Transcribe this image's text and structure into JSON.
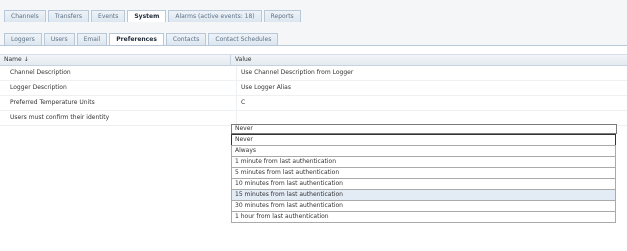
{
  "top_tabs": [
    {
      "label": "Channels"
    },
    {
      "label": "Transfers"
    },
    {
      "label": "Events"
    },
    {
      "label": "System",
      "active": true
    },
    {
      "label": "Alarms (active events: 18)"
    },
    {
      "label": "Reports"
    }
  ],
  "sub_tabs": [
    {
      "label": "Loggers"
    },
    {
      "label": "Users"
    },
    {
      "label": "Email"
    },
    {
      "label": "Preferences",
      "active": true
    },
    {
      "label": "Contacts"
    },
    {
      "label": "Contact Schedules"
    }
  ],
  "grid": {
    "col_name": "Name ↓",
    "col_value": "Value",
    "rows": [
      {
        "name": "Channel Description",
        "value": "Use Channel Description from Logger"
      },
      {
        "name": "Logger Description",
        "value": "Use Logger Alias"
      },
      {
        "name": "Preferred Temperature Units",
        "value": "C"
      },
      {
        "name": "Users must confirm their identity",
        "value": ""
      }
    ]
  },
  "dropdown": {
    "current": "Never",
    "options": [
      {
        "label": "Never",
        "selected": true
      },
      {
        "label": "Always"
      },
      {
        "label": "1 minute from last authentication"
      },
      {
        "label": "5 minutes from last authentication"
      },
      {
        "label": "10 minutes from last authentication"
      },
      {
        "label": "15 minutes from last authentication",
        "hover": true
      },
      {
        "label": "30 minutes from last authentication"
      },
      {
        "label": "1 hour from last authentication"
      }
    ]
  }
}
